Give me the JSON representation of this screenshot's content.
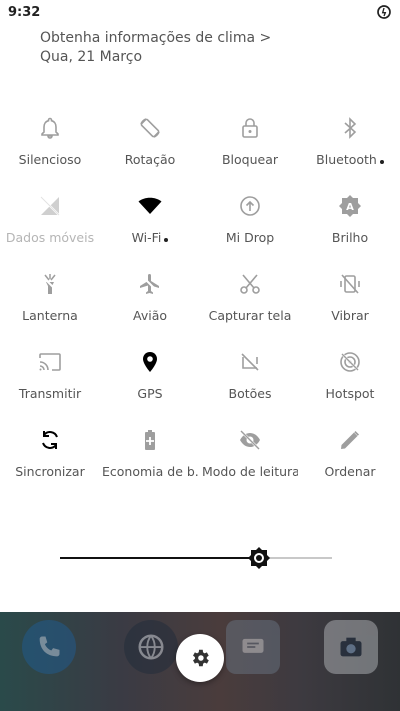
{
  "status_bar": {
    "time": "9:32",
    "right_icon": "data-saver-icon"
  },
  "header": {
    "weather_link": "Obtenha informações de clima >",
    "date": "Qua, 21 Março"
  },
  "tiles": [
    {
      "label": "Silencioso",
      "icon": "bell-icon",
      "active": false
    },
    {
      "label": "Rotação",
      "icon": "rotation-icon",
      "active": false
    },
    {
      "label": "Bloquear",
      "icon": "lock-icon",
      "active": false
    },
    {
      "label": "Bluetooth",
      "icon": "bluetooth-icon",
      "active": false,
      "dot": true
    },
    {
      "label": "Dados móveis",
      "icon": "mobile-data-off-icon",
      "active": false,
      "disabled": true
    },
    {
      "label": "Wi-Fi",
      "icon": "wifi-icon",
      "active": true,
      "dot": true
    },
    {
      "label": "Mi Drop",
      "icon": "mi-drop-icon",
      "active": false
    },
    {
      "label": "Brilho",
      "icon": "brightness-auto-icon",
      "active": false
    },
    {
      "label": "Lanterna",
      "icon": "flashlight-icon",
      "active": false
    },
    {
      "label": "Avião",
      "icon": "airplane-icon",
      "active": false
    },
    {
      "label": "Capturar tela",
      "icon": "scissors-icon",
      "active": false
    },
    {
      "label": "Vibrar",
      "icon": "vibrate-icon",
      "active": false
    },
    {
      "label": "Transmitir",
      "icon": "cast-icon",
      "active": false
    },
    {
      "label": "GPS",
      "icon": "location-pin-icon",
      "active": true
    },
    {
      "label": "Botões",
      "icon": "buttons-icon",
      "active": false
    },
    {
      "label": "Hotspot",
      "icon": "hotspot-icon",
      "active": false
    },
    {
      "label": "Sincronizar",
      "icon": "sync-icon",
      "active": true
    },
    {
      "label": "Economia de b..",
      "icon": "battery-saver-icon",
      "active": false
    },
    {
      "label": "Modo de leitura",
      "icon": "eye-off-icon",
      "active": false
    },
    {
      "label": "Ordenar",
      "icon": "pencil-icon",
      "active": false
    }
  ],
  "brightness": {
    "level": 0.73,
    "icon": "brightness-thumb-icon"
  },
  "home_screen": {
    "apps": [
      "phone-icon",
      "browser-icon",
      "messages-icon",
      "camera-icon"
    ],
    "settings_button_icon": "gear-icon"
  },
  "colors": {
    "active": "#000000",
    "inactive": "#9e9e9e",
    "disabled": "#cfcfcf"
  }
}
